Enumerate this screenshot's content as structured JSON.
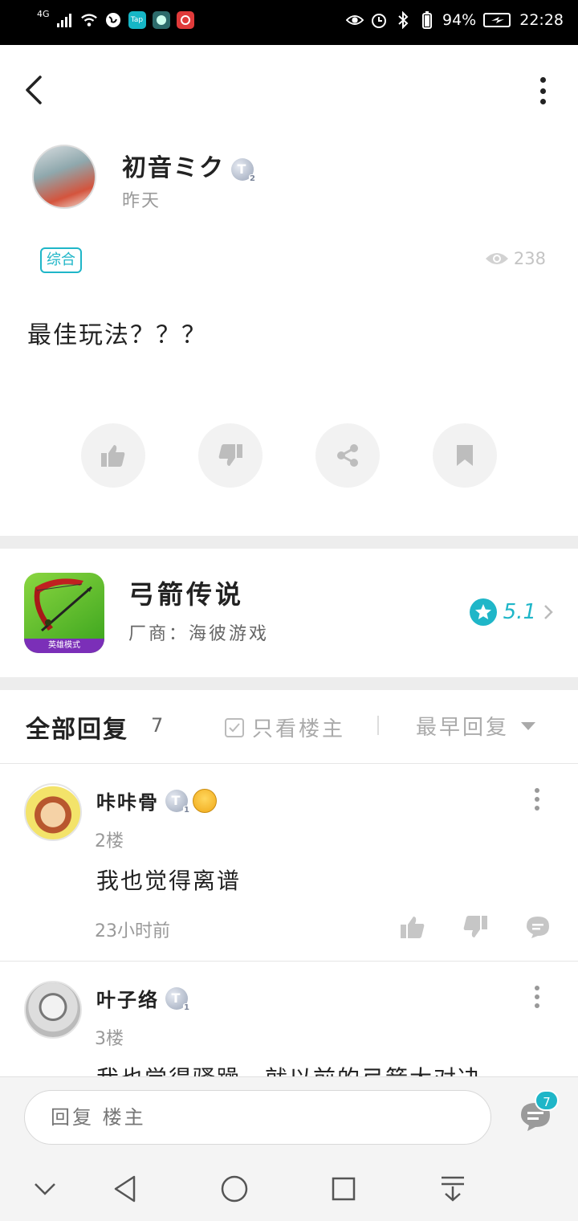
{
  "status_bar": {
    "network": "4G",
    "battery": "94%",
    "time": "22:28",
    "app_icons": [
      "globe-icon",
      "taptap-icon",
      "app-icon",
      "music-icon"
    ],
    "tap_label": "Tap"
  },
  "post": {
    "author_name": "初音ミク",
    "author_level": "T",
    "author_level_num": "2",
    "time": "昨天",
    "tag": "综合",
    "views": "238",
    "content": "最佳玩法？？？"
  },
  "game": {
    "title": "弓箭传说",
    "developer": "厂商：海彼游戏",
    "rating": "5.1",
    "icon_label": "英雄模式"
  },
  "replies_header": {
    "title": "全部回复",
    "count": "7",
    "only_owner": "只看楼主",
    "sort": "最早回复"
  },
  "comments": [
    {
      "name": "咔咔骨",
      "level": "T",
      "level_num": "1",
      "floor": "2楼",
      "text": "我也觉得离谱",
      "time": "23小时前"
    },
    {
      "name": "叶子络",
      "level": "T",
      "level_num": "1",
      "floor": "3楼",
      "text": "我也觉得骚躁，就以前的弓箭大对决"
    }
  ],
  "reply_bar": {
    "placeholder": "回复 楼主",
    "message_count": "7"
  },
  "colors": {
    "accent": "#1fb6c8",
    "divider": "#ededed"
  }
}
